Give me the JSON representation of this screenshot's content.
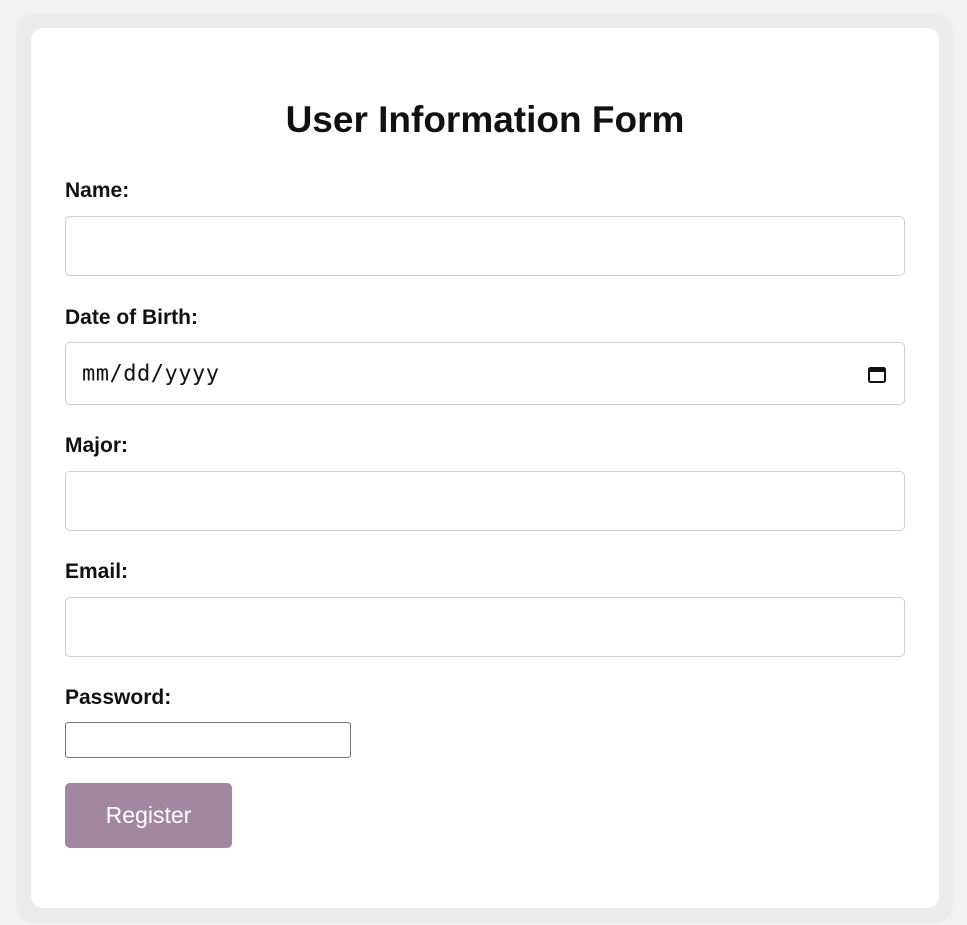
{
  "form": {
    "title": "User Information Form",
    "fields": {
      "name": {
        "label": "Name:",
        "value": "",
        "placeholder": ""
      },
      "date_of_birth": {
        "label": "Date of Birth:",
        "value": "mm/dd/yyyy"
      },
      "major": {
        "label": "Major:",
        "value": "",
        "placeholder": ""
      },
      "email": {
        "label": "Email:",
        "value": "",
        "placeholder": ""
      },
      "password": {
        "label": "Password:",
        "value": ""
      }
    },
    "submit_label": "Register"
  },
  "icons": {
    "date_picker": "calendar-icon"
  },
  "colors": {
    "page_background": "#f2f2f2",
    "card_background": "#ffffff",
    "button_background": "#a3869f",
    "button_text": "#ffffff",
    "text": "#111111"
  }
}
